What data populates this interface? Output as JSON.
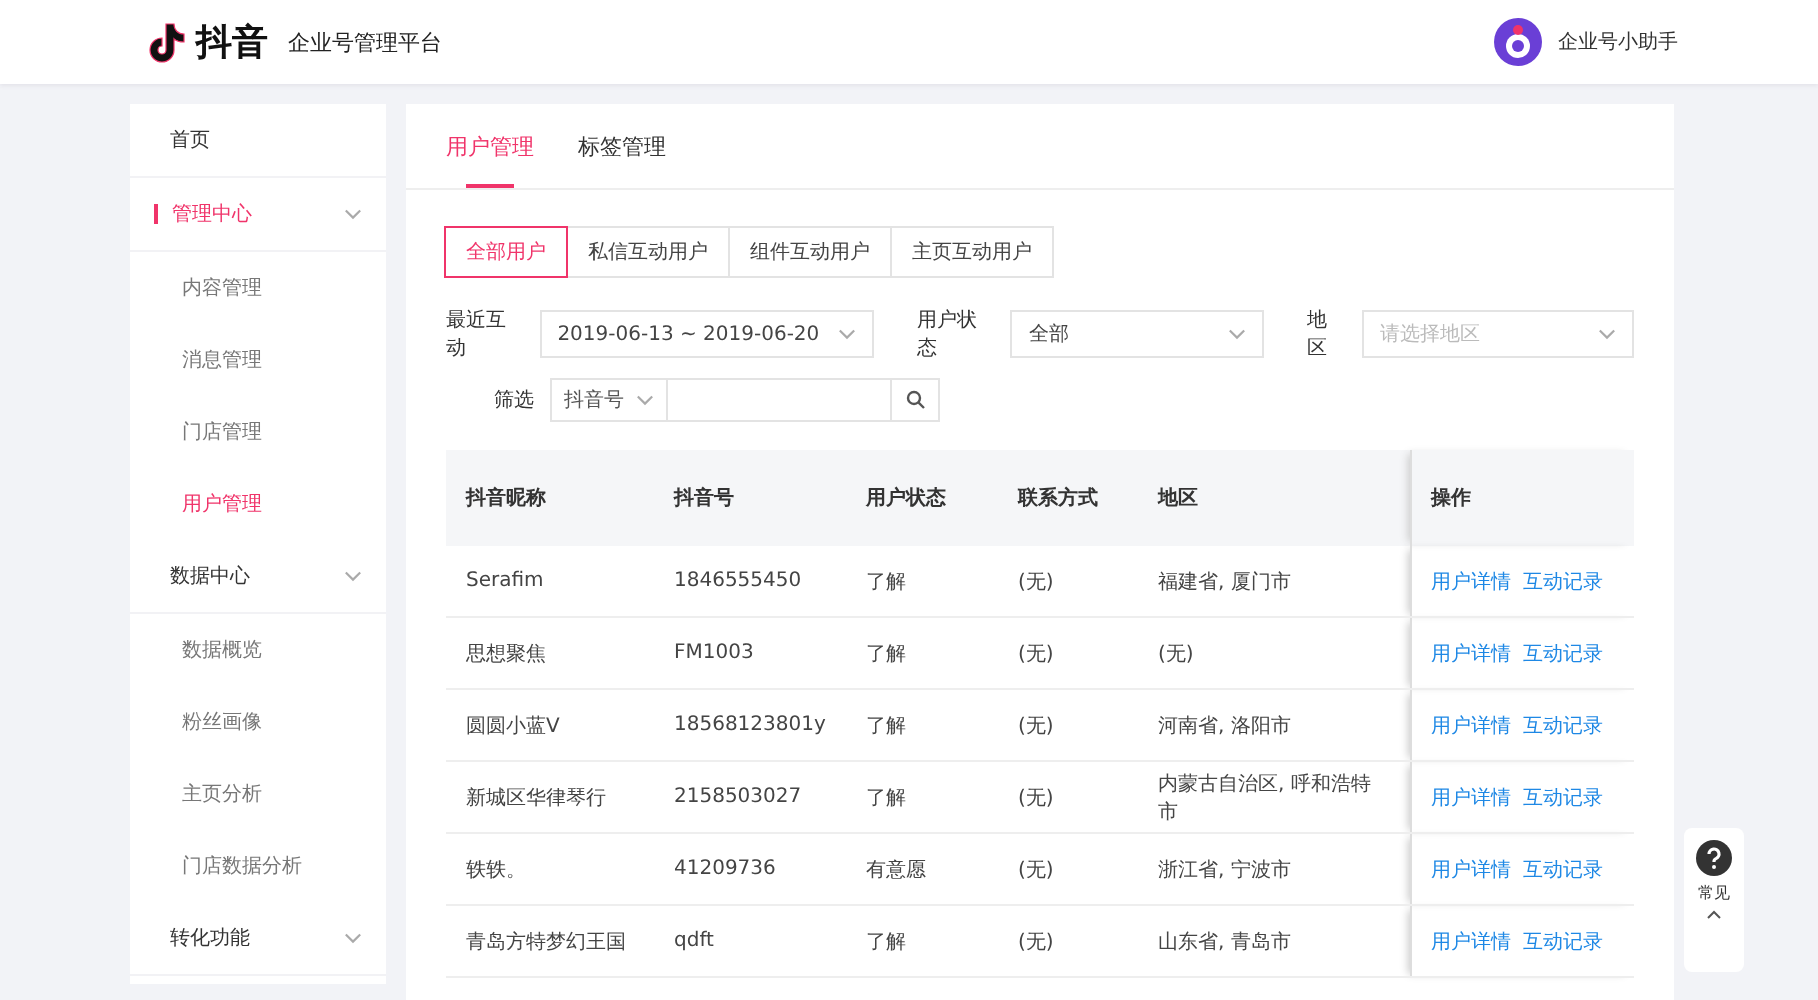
{
  "header": {
    "logo_text": "抖音",
    "platform": "企业号管理平台",
    "assistant": "企业号小助手"
  },
  "sidebar": {
    "items": [
      {
        "label": "首页",
        "kind": "link",
        "selected": false
      },
      {
        "label": "管理中心",
        "kind": "group",
        "selected": true,
        "children": [
          {
            "label": "内容管理",
            "selected": false
          },
          {
            "label": "消息管理",
            "selected": false
          },
          {
            "label": "门店管理",
            "selected": false
          },
          {
            "label": "用户管理",
            "selected": true
          }
        ]
      },
      {
        "label": "数据中心",
        "kind": "group",
        "selected": false,
        "children": [
          {
            "label": "数据概览",
            "selected": false
          },
          {
            "label": "粉丝画像",
            "selected": false
          },
          {
            "label": "主页分析",
            "selected": false
          },
          {
            "label": "门店数据分析",
            "selected": false
          }
        ]
      },
      {
        "label": "转化功能",
        "kind": "group",
        "selected": false
      }
    ]
  },
  "tabs": [
    {
      "label": "用户管理",
      "selected": true
    },
    {
      "label": "标签管理",
      "selected": false
    }
  ],
  "segments": [
    {
      "label": "全部用户",
      "selected": true
    },
    {
      "label": "私信互动用户",
      "selected": false
    },
    {
      "label": "组件互动用户",
      "selected": false
    },
    {
      "label": "主页互动用户",
      "selected": false
    }
  ],
  "filters": [
    {
      "label": "最近互动",
      "value": "2019-06-13 ~ 2019-06-20",
      "kind": "date"
    },
    {
      "label": "用户状态",
      "value": "全部",
      "kind": "select"
    },
    {
      "label": "地区",
      "placeholder": "请选择地区",
      "kind": "select"
    }
  ],
  "search": {
    "label": "筛选",
    "type": "抖音号"
  },
  "table": {
    "columns": [
      "抖音昵称",
      "抖音号",
      "用户状态",
      "联系方式",
      "地区",
      "操作"
    ],
    "rows": [
      {
        "cells": [
          "Serafim",
          "1846555450",
          "了解",
          "(无)",
          "福建省, 厦门市"
        ],
        "actions": [
          "用户详情",
          "互动记录"
        ]
      },
      {
        "cells": [
          "思想聚焦",
          "FM1003",
          "了解",
          "(无)",
          "(无)"
        ],
        "actions": [
          "用户详情",
          "互动记录"
        ]
      },
      {
        "cells": [
          "圆圆小蓝V",
          "18568123801y",
          "了解",
          "(无)",
          "河南省, 洛阳市"
        ],
        "actions": [
          "用户详情",
          "互动记录"
        ]
      },
      {
        "cells": [
          "新城区华律琴行",
          "2158503027",
          "了解",
          "(无)",
          "内蒙古自治区, 呼和浩特市"
        ],
        "actions": [
          "用户详情",
          "互动记录"
        ]
      },
      {
        "cells": [
          "轶轶。",
          "41209736",
          "有意愿",
          "(无)",
          "浙江省, 宁波市"
        ],
        "actions": [
          "用户详情",
          "互动记录"
        ]
      },
      {
        "cells": [
          "青岛方特梦幻王国",
          "qdft",
          "了解",
          "(无)",
          "山东省, 青岛市"
        ],
        "actions": [
          "用户详情",
          "互动记录"
        ]
      }
    ]
  },
  "help": {
    "label": "常见"
  }
}
